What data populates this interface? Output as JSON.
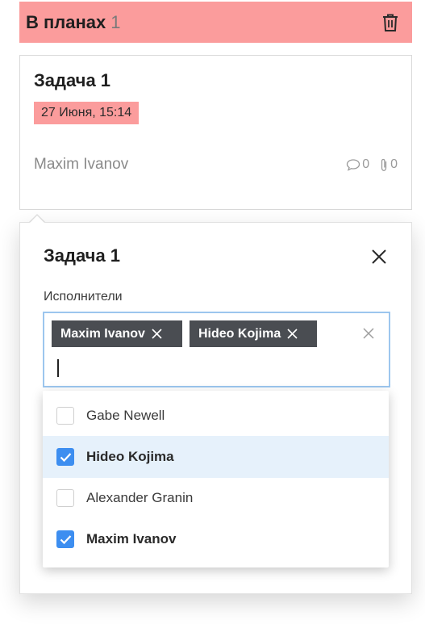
{
  "column": {
    "title": "В планах",
    "count": "1",
    "accent_color": "#fb9c9c",
    "delete_icon": "trash-icon"
  },
  "card": {
    "title": "Задача 1",
    "due": "27 Июня, 15:14",
    "assignee": "Maxim Ivanov",
    "comments": "0",
    "attachments": "0",
    "comment_icon": "comment-icon",
    "attachment_icon": "paperclip-icon"
  },
  "popover": {
    "title": "Задача 1",
    "field_label": "Исполнители",
    "selected_tags": [
      "Maxim Ivanov",
      "Hideo Kojima"
    ],
    "input_value": "",
    "options": [
      {
        "label": "Gabe Newell",
        "checked": false
      },
      {
        "label": "Hideo Kojima",
        "checked": true
      },
      {
        "label": "Alexander Granin",
        "checked": false
      },
      {
        "label": "Maxim Ivanov",
        "checked": true
      }
    ],
    "checkbox_color": "#3d8ef0",
    "highlight_color": "#e6f1fb",
    "focus_border_color": "#9cc6ee"
  }
}
